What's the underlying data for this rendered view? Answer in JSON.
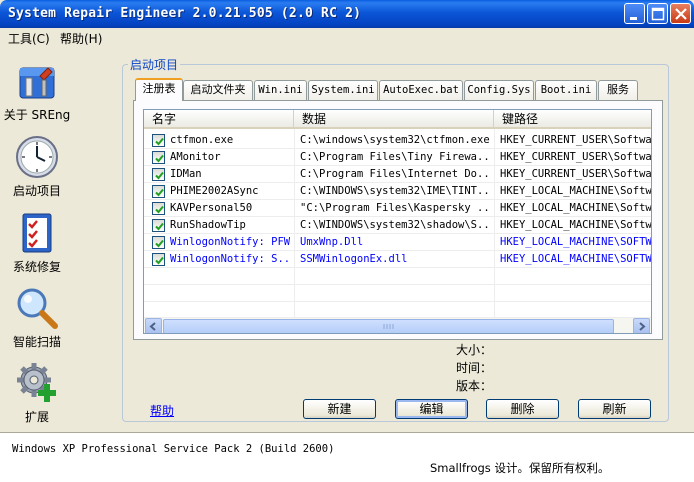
{
  "window": {
    "title": "System Repair Engineer 2.0.21.505 (2.0 RC 2)"
  },
  "menu": {
    "tools": "工具(C)",
    "help": "帮助(H)"
  },
  "nav": [
    {
      "label": "关于 SREng",
      "icon": "toolbox-icon"
    },
    {
      "label": "启动项目",
      "icon": "clock-icon"
    },
    {
      "label": "系统修复",
      "icon": "checklist-icon"
    },
    {
      "label": "智能扫描",
      "icon": "magnifier-icon"
    },
    {
      "label": "扩展",
      "icon": "gear-plus-icon"
    }
  ],
  "group_title": "启动项目",
  "tabs": [
    "注册表",
    "启动文件夹",
    "Win.ini",
    "System.ini",
    "AutoExec.bat",
    "Config.Sys",
    "Boot.ini",
    "服务"
  ],
  "active_tab": "注册表",
  "columns": [
    "名字",
    "数据",
    "键路径"
  ],
  "rows": [
    {
      "checked": true,
      "name": "ctfmon.exe",
      "data": "C:\\windows\\system32\\ctfmon.exe",
      "key": "HKEY_CURRENT_USER\\Softwar",
      "highlight": false
    },
    {
      "checked": true,
      "name": "AMonitor",
      "data": "C:\\Program Files\\Tiny Firewa...",
      "key": "HKEY_CURRENT_USER\\Softwar",
      "highlight": false
    },
    {
      "checked": true,
      "name": "IDMan",
      "data": "C:\\Program Files\\Internet Do...",
      "key": "HKEY_CURRENT_USER\\Softwar",
      "highlight": false
    },
    {
      "checked": true,
      "name": "PHIME2002ASync",
      "data": "C:\\WINDOWS\\system32\\IME\\TINT...",
      "key": "HKEY_LOCAL_MACHINE\\Softwa",
      "highlight": false
    },
    {
      "checked": true,
      "name": "KAVPersonal50",
      "data": "\"C:\\Program Files\\Kaspersky ...",
      "key": "HKEY_LOCAL_MACHINE\\Softwa",
      "highlight": false
    },
    {
      "checked": true,
      "name": "RunShadowTip",
      "data": "C:\\WINDOWS\\system32\\shadow\\S...",
      "key": "HKEY_LOCAL_MACHINE\\Softwa",
      "highlight": false
    },
    {
      "checked": true,
      "name": "WinlogonNotify: PFW",
      "data": "UmxWnp.Dll",
      "key": "HKEY_LOCAL_MACHINE\\SOFTWA",
      "highlight": true
    },
    {
      "checked": true,
      "name": "WinlogonNotify: S...",
      "data": "SSMWinlogonEx.dll",
      "key": "HKEY_LOCAL_MACHINE\\SOFTWA",
      "highlight": true
    }
  ],
  "info": {
    "size_label": "大小：",
    "time_label": "时间：",
    "version_label": "版本："
  },
  "buttons": {
    "new": "新建",
    "edit": "编辑",
    "delete": "删除",
    "refresh": "刷新"
  },
  "help_link": "帮助",
  "status": {
    "os": "Windows XP Professional Service Pack 2 (Build 2600)",
    "credit": "Smallfrogs 设计。保留所有权利。"
  },
  "colors": {
    "titlebar": "#0b56d8",
    "link": "#0000ff",
    "group_title": "#0b46c8",
    "highlight_row": "#0000ff"
  }
}
